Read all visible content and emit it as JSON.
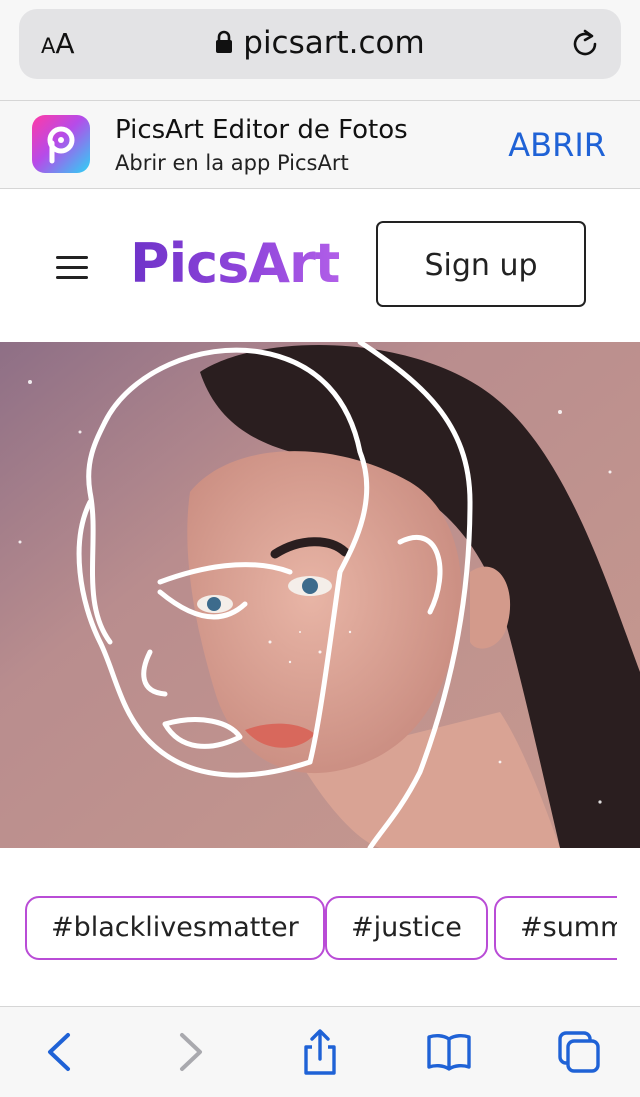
{
  "browser": {
    "text_size_label": "AA",
    "url": "picsart.com"
  },
  "app_banner": {
    "title": "PicsArt Editor de Fotos",
    "subtitle": "Abrir en la app PicsArt",
    "open_label": "ABRIR"
  },
  "header": {
    "logo_text": "PicsArt",
    "signup_label": "Sign up"
  },
  "hashtags": [
    "#blacklivesmatter",
    "#justice",
    "#summ"
  ],
  "colors": {
    "brand_purple": "#7a3ad3",
    "tag_border": "#b94cd6",
    "ios_link_blue": "#1f62d6"
  },
  "toolbar": {
    "icons": [
      "back-icon",
      "forward-icon",
      "share-icon",
      "bookmarks-icon",
      "tabs-icon"
    ]
  }
}
